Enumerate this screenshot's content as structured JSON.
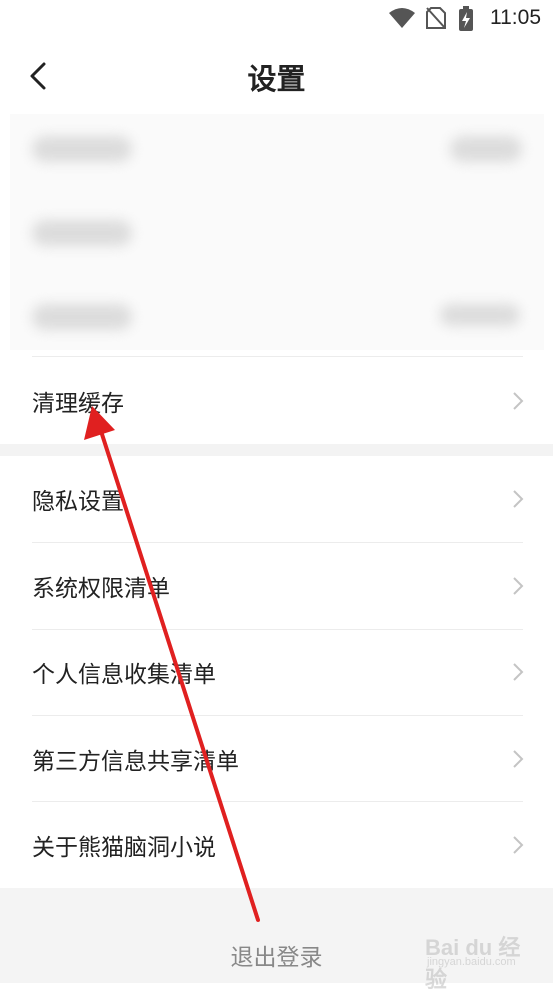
{
  "status_bar": {
    "time": "11:05",
    "icons": [
      "wifi-icon",
      "no-sim-icon",
      "battery-charging-icon"
    ]
  },
  "header": {
    "title": "设置",
    "back_icon": "chevron-left-icon"
  },
  "settings_top": [
    {
      "label": "清理缓存"
    }
  ],
  "settings_main": [
    {
      "label": "隐私设置"
    },
    {
      "label": "系统权限清单"
    },
    {
      "label": "个人信息收集清单"
    },
    {
      "label": "第三方信息共享清单"
    },
    {
      "label": "关于熊猫脑洞小说"
    }
  ],
  "logout": {
    "label": "退出登录"
  },
  "watermark": {
    "text": "Bai du 经验",
    "sub": "jingyan.baidu.com"
  },
  "colors": {
    "annotation_arrow": "#e02020",
    "background": "#ffffff",
    "section_gap": "#f3f3f3"
  }
}
